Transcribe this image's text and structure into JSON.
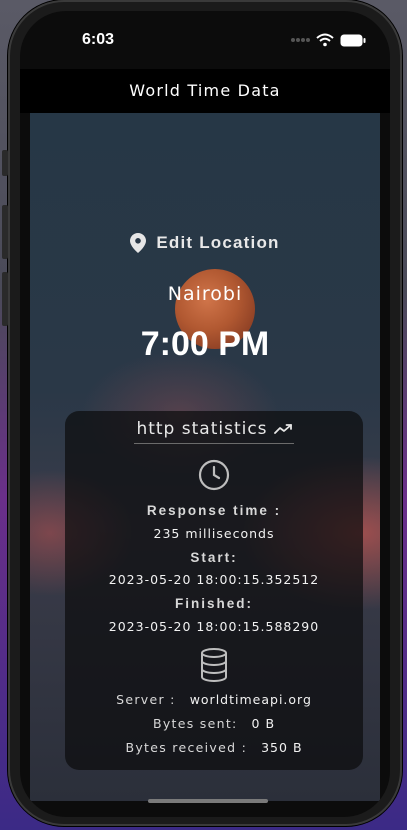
{
  "status_bar": {
    "time": "6:03"
  },
  "app_bar": {
    "title": "World Time Data"
  },
  "location": {
    "edit_label": "Edit Location",
    "city": "Nairobi",
    "time": "7:00 PM"
  },
  "http_stats": {
    "title": "http statistics",
    "response_time_label": "Response time :",
    "response_time_value": "235 milliseconds",
    "start_label": "Start:",
    "start_value": "2023-05-20 18:00:15.352512",
    "finished_label": "Finished:",
    "finished_value": "2023-05-20 18:00:15.588290",
    "server_label": "Server :",
    "server_value": "worldtimeapi.org",
    "bytes_sent_label": "Bytes sent:",
    "bytes_sent_value": "0 B",
    "bytes_received_label": "Bytes received :",
    "bytes_received_value": "350 B"
  },
  "icons": {
    "location": "location-pin-icon",
    "chart": "trending-icon",
    "clock": "clock-icon",
    "database": "database-icon"
  }
}
